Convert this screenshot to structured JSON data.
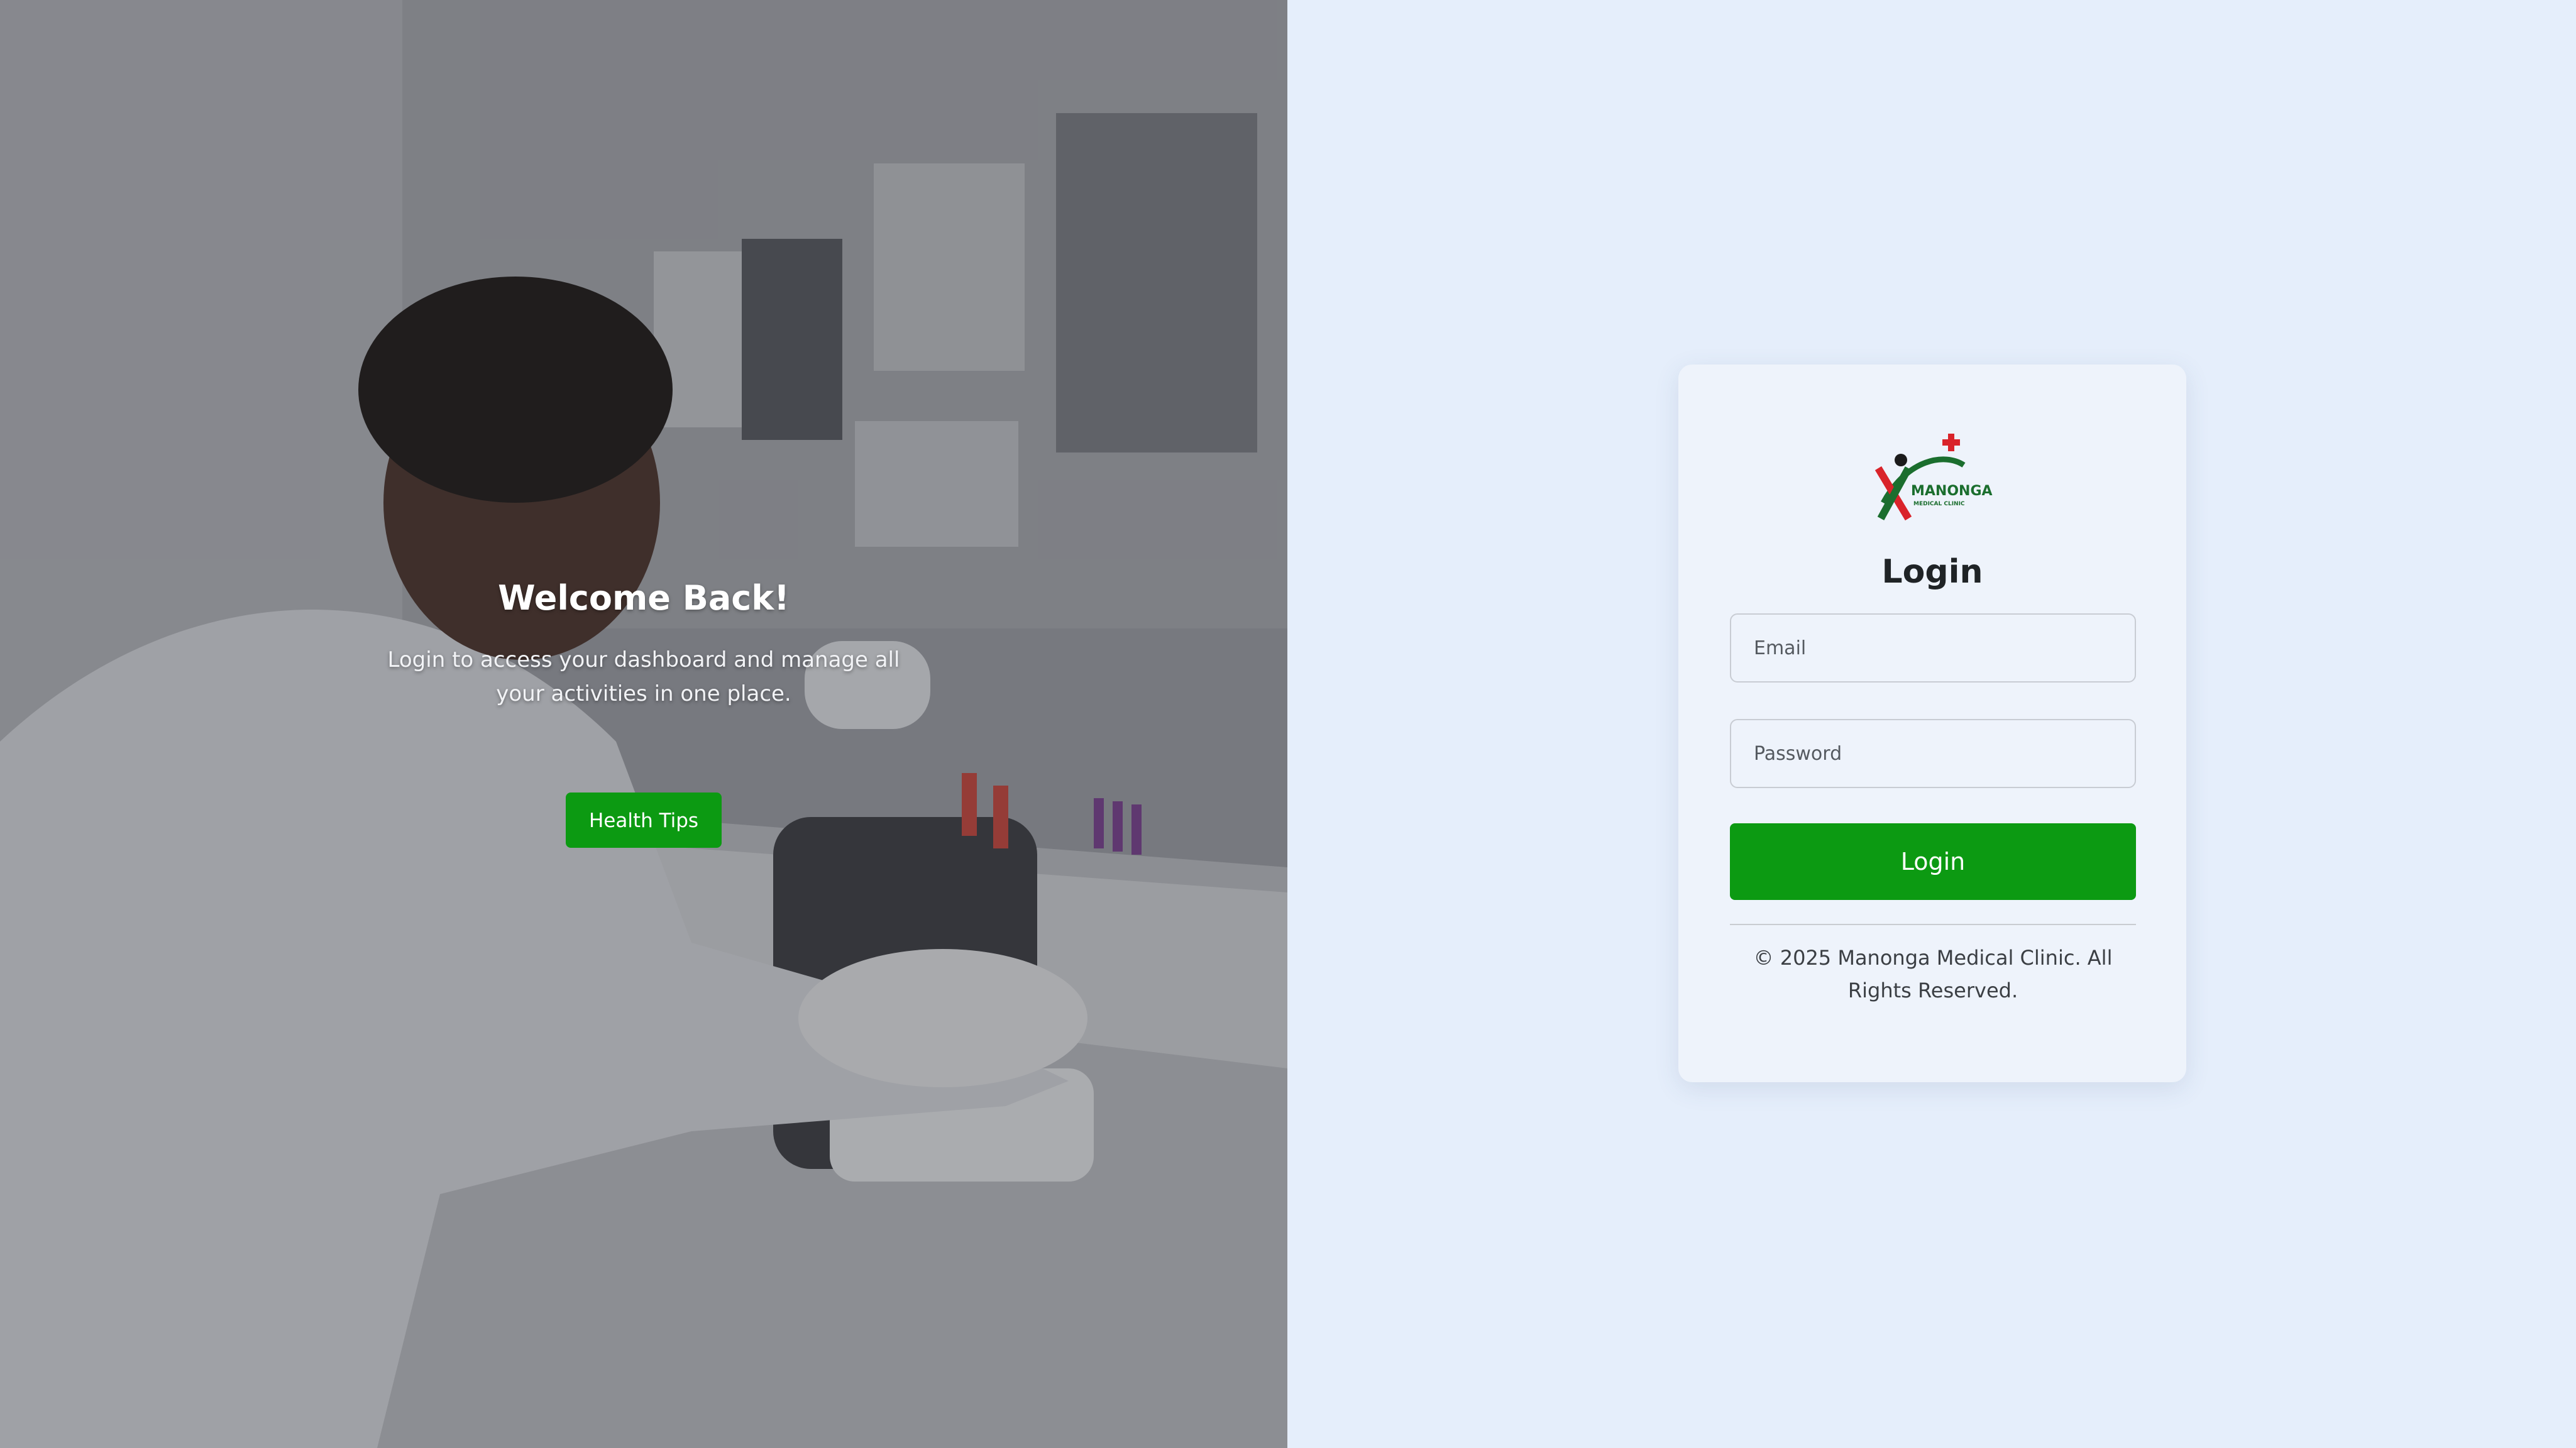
{
  "hero": {
    "title": "Welcome Back!",
    "subtitle": "Login to access your dashboard and manage all your activities in one place.",
    "button_label": "Health Tips"
  },
  "login_card": {
    "logo": {
      "brand_text": "MANONGA",
      "brand_subtext": "MEDICAL CLINIC"
    },
    "title": "Login",
    "email_placeholder": "Email",
    "password_placeholder": "Password",
    "submit_label": "Login",
    "footer": "© 2025 Manonga Medical Clinic. All Rights Reserved."
  },
  "colors": {
    "primary_green": "#0c9a12",
    "panel_background": "#e5eefb",
    "logo_red": "#d9232a",
    "logo_dark_green": "#1b6e2e"
  }
}
